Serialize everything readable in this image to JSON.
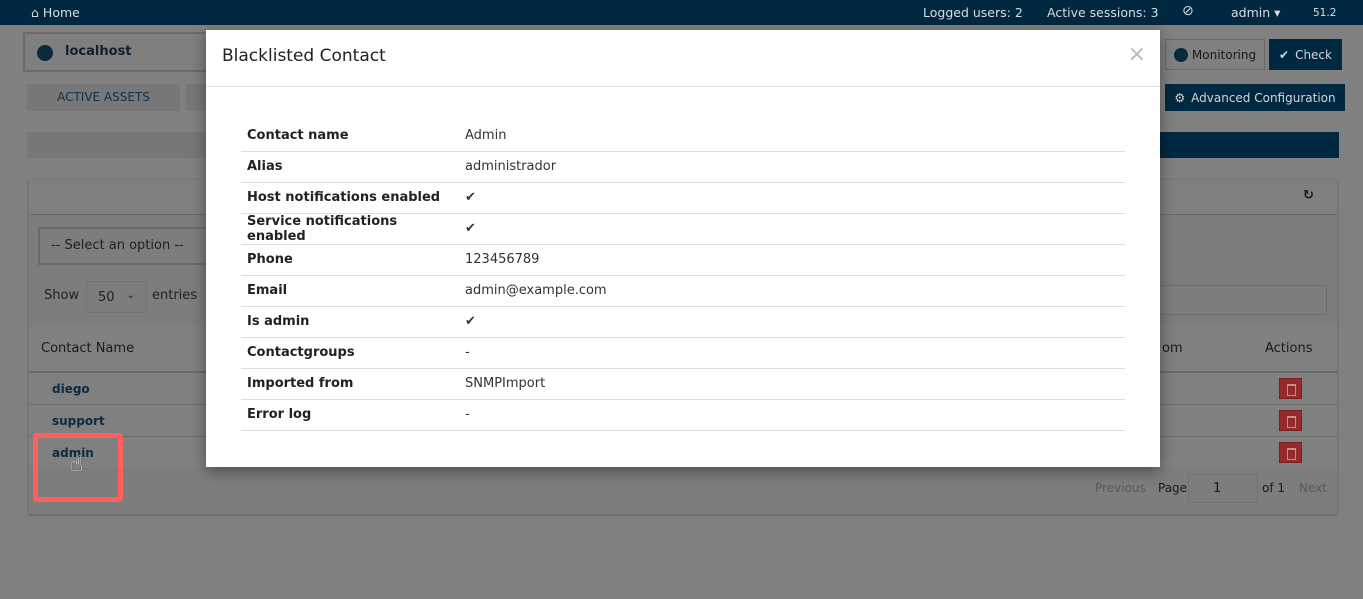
{
  "nav": {
    "home": "Home",
    "logged_users": "Logged users: 2",
    "active_sessions": "Active sessions: 3",
    "user": "admin",
    "version": "51.2"
  },
  "header": {
    "host": "localhost",
    "monitoring": "Monitoring",
    "check": "Check",
    "tab_active_assets": "ACTIVE ASSETS",
    "advanced_config": "Advanced Configuration"
  },
  "filters": {
    "select_placeholder": "-- Select an option --",
    "show_label": "Show",
    "entries_value": "50",
    "entries_label": "entries"
  },
  "table": {
    "columns": [
      "Contact Name",
      "om",
      "Actions"
    ],
    "rows": [
      "diego",
      "support",
      "admin"
    ]
  },
  "pagination": {
    "previous": "Previous",
    "page_label": "Page",
    "page": "1",
    "of": "of 1",
    "next": "Next"
  },
  "modal": {
    "title": "Blacklisted Contact",
    "close": "×",
    "fields": [
      {
        "label": "Contact name",
        "value": "Admin"
      },
      {
        "label": "Alias",
        "value": "administrador"
      },
      {
        "label": "Host notifications enabled",
        "value": "✔"
      },
      {
        "label": "Service notifications enabled",
        "value": "✔"
      },
      {
        "label": "Phone",
        "value": "123456789"
      },
      {
        "label": "Email",
        "value": "admin@example.com"
      },
      {
        "label": "Is admin",
        "value": "✔"
      },
      {
        "label": "Contactgroups",
        "value": "-"
      },
      {
        "label": "Imported from",
        "value": "SNMPImport"
      },
      {
        "label": "Error log",
        "value": "-"
      }
    ]
  },
  "colors": {
    "navbar": "#002840",
    "danger": "#962a2a",
    "highlight": "#ff5f5f"
  }
}
